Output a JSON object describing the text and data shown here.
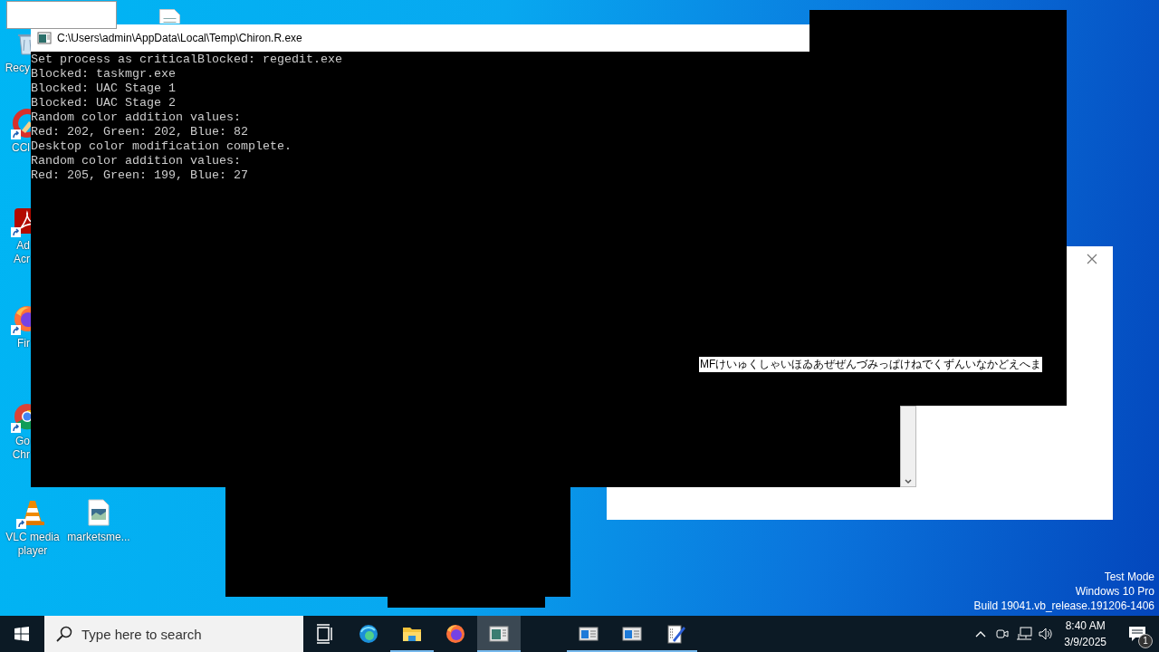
{
  "desktop_icons": [
    {
      "kind": "recycle-bin",
      "label_lines": [
        "Recy"
      ],
      "shortcut": false
    },
    {
      "kind": "ccleaner",
      "label_lines": [
        "CCl"
      ],
      "shortcut": true
    },
    {
      "kind": "acrobat",
      "label_lines": [
        "Ad",
        "Acr"
      ],
      "shortcut": true
    },
    {
      "kind": "firefox",
      "label_lines": [
        "Fir"
      ],
      "shortcut": true
    },
    {
      "kind": "chrome",
      "label_lines": [
        "Go",
        "Chr"
      ],
      "shortcut": true
    },
    {
      "kind": "vlc",
      "label_lines": [
        "VLC media player"
      ],
      "shortcut": true
    },
    {
      "kind": "image-file",
      "label_lines": [
        "marketsme..."
      ],
      "shortcut": false
    },
    {
      "kind": "document",
      "shortcut": false
    }
  ],
  "console_window": {
    "title": "C:\\Users\\admin\\AppData\\Local\\Temp\\Chiron.R.exe",
    "lines": [
      "Set process as criticalBlocked: regedit.exe",
      "Blocked: taskmgr.exe",
      "Blocked: UAC Stage 1",
      "Blocked: UAC Stage 2",
      "Random color addition values:",
      "Red: 202, Green: 202, Blue: 82",
      "Desktop color modification complete.",
      "Random color addition values:",
      "Red: 205, Green: 199, Blue: 27"
    ]
  },
  "overlay_text": "MFけいゅくしゃいほゐあぜぜんづみっぱけねでくずんいなかどえへま",
  "os_info": [
    "Test Mode",
    "Windows 10 Pro",
    "Build 19041.vb_release.191206-1406"
  ],
  "taskbar": {
    "search_placeholder": "Type here to search",
    "apps": [
      {
        "kind": "task-view",
        "running": false,
        "active": false
      },
      {
        "kind": "edge",
        "running": false,
        "active": false
      },
      {
        "kind": "explorer",
        "running": true,
        "active": false
      },
      {
        "kind": "firefox",
        "running": false,
        "active": false
      },
      {
        "kind": "console",
        "running": true,
        "active": true
      },
      {
        "kind": "gap"
      },
      {
        "kind": "window",
        "running": true,
        "active": false
      },
      {
        "kind": "window",
        "running": true,
        "active": false
      },
      {
        "kind": "notepad",
        "running": true,
        "active": false
      }
    ],
    "clock": {
      "time": "8:40 AM",
      "date": "3/9/2025"
    },
    "notification_count": "1"
  }
}
